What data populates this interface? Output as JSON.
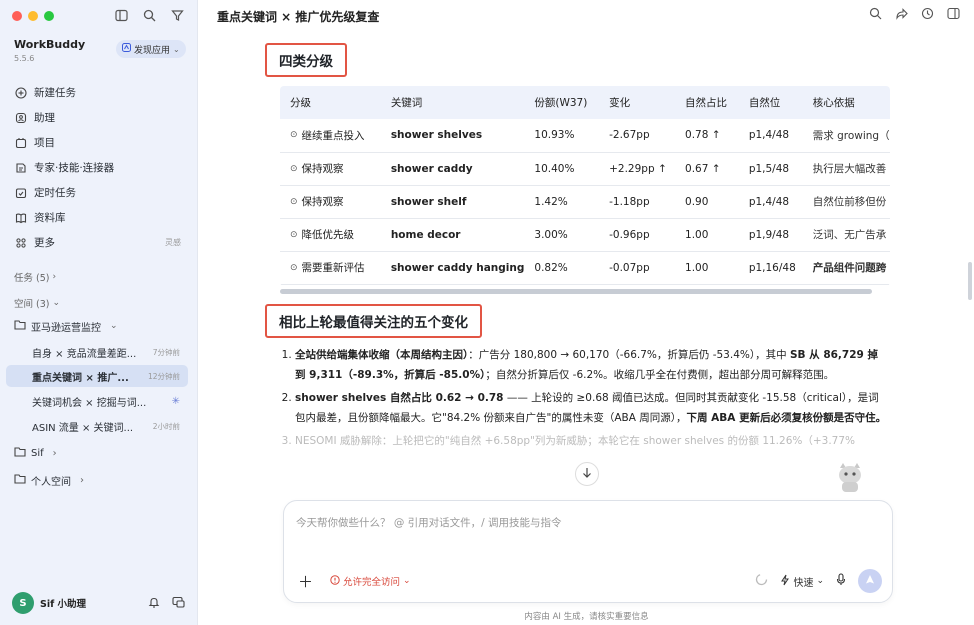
{
  "sidebar": {
    "app_name": "WorkBuddy",
    "version": "5.5.6",
    "discover_label": "发现应用",
    "nav": [
      {
        "label": "新建任务",
        "icon": "plus-circle-icon"
      },
      {
        "label": "助理",
        "icon": "assistant-icon"
      },
      {
        "label": "项目",
        "icon": "project-icon"
      },
      {
        "label": "专家·技能·连接器",
        "icon": "expert-icon"
      },
      {
        "label": "定时任务",
        "icon": "calendar-check-icon"
      },
      {
        "label": "资料库",
        "icon": "book-icon"
      },
      {
        "label": "更多",
        "icon": "grid-icon",
        "shortcut": "灵感"
      }
    ],
    "tasks_label": "任务 (5)",
    "spaces_label": "空间 (3)",
    "space_amazon": "亚马逊运营监控",
    "sub_items": [
      {
        "label": "自身 × 竞品流量差距...",
        "time": "7分钟前"
      },
      {
        "label": "重点关键词 × 推广...",
        "time": "12分钟前"
      },
      {
        "label": "关键词机会 × 挖掘与词...",
        "time": ""
      },
      {
        "label": "ASIN 流量 × 关键词...",
        "time": "2小时前"
      }
    ],
    "space_sif": "Sif",
    "space_personal": "个人空间",
    "user_name": "Sif 小助理",
    "avatar_text": "S"
  },
  "header": {
    "title": "重点关键词 × 推广优先级复查"
  },
  "section1": {
    "heading": "四类分级"
  },
  "table": {
    "columns": [
      "分级",
      "关键词",
      "份额(W37)",
      "变化",
      "自然占比",
      "自然位",
      "核心依据"
    ],
    "rows": [
      {
        "tier": "继续重点投入",
        "tier_icon": "circle-icon",
        "keyword": "shower shelves",
        "share": "10.93%",
        "change": "-2.67pp",
        "natural_share": "0.78 ↑",
        "natural_pos": "p1,4/48",
        "basis": "需求 growing（",
        "basis_bold": false
      },
      {
        "tier": "保持观察",
        "tier_icon": "circle-icon",
        "keyword": "shower caddy",
        "share": "10.40%",
        "change": "+2.29pp ↑",
        "natural_share": "0.67 ↑",
        "natural_pos": "p1,5/48",
        "basis": "执行层大幅改善",
        "basis_bold": false
      },
      {
        "tier": "保持观察",
        "tier_icon": "circle-icon",
        "keyword": "shower shelf",
        "share": "1.42%",
        "change": "-1.18pp",
        "natural_share": "0.90",
        "natural_pos": "p1,4/48",
        "basis": "自然位前移但份",
        "basis_bold": false
      },
      {
        "tier": "降低优先级",
        "tier_icon": "circle-icon",
        "keyword": "home decor",
        "share": "3.00%",
        "change": "-0.96pp",
        "natural_share": "1.00",
        "natural_pos": "p1,9/48",
        "basis": "泛词、无广告承",
        "basis_bold": false
      },
      {
        "tier": "需要重新评估",
        "tier_icon": "circle-icon",
        "keyword": "shower caddy hanging",
        "share": "0.82%",
        "change": "-0.07pp",
        "natural_share": "1.00",
        "natural_pos": "p1,16/48",
        "basis": "产品组件问题跨",
        "basis_bold": true
      }
    ]
  },
  "section2": {
    "heading": "相比上轮最值得关注的五个变化"
  },
  "changes": {
    "item1_bold": "全站供给端集体收缩（本周结构主因）",
    "item1_text_a": "：广告分 180,800 → 60,170（-66.7%，折算后仍 -53.4%），其中 ",
    "item1_bold_b": "SB 从 86,729 掉到 9,311（-89.3%，折算后 -85.0%）",
    "item1_text_c": "；自然分折算后仅 -6.2%。收缩几乎全在付费侧，超出部分周可解释范围。",
    "item2_bold": "shower shelves 自然占比 0.62 → 0.78",
    "item2_text_a": " —— 上轮设的 ≥0.68 阈值已达成。但同时其贡献变化 -15.58（critical），是词包内最差，且份额降幅最大。它\"84.2% 份额来自广告\"的属性未变（ABA 周同源），",
    "item2_bold_b": "下周 ABA 更新后必须复核份额是否守住。",
    "item3_text": "NESOMI 威胁解除：上轮把它的\"纯自然 +6.58pp\"列为新威胁；本轮它在 shower shelves 的份额 11.26%（+3.77%"
  },
  "composer": {
    "placeholder": "今天帮你做些什么？ @ 引用对话文件，/ 调用技能与指令",
    "access_label": "允许完全访问",
    "mode_label": "快速"
  },
  "disclaimer": "内容由 AI 生成，请核实重要信息",
  "colors": {
    "accent_red": "#e25544",
    "sidebar_bg": "#eef2fb",
    "active_bg": "#d6e0f4",
    "table_header_bg": "#eef2fb"
  }
}
